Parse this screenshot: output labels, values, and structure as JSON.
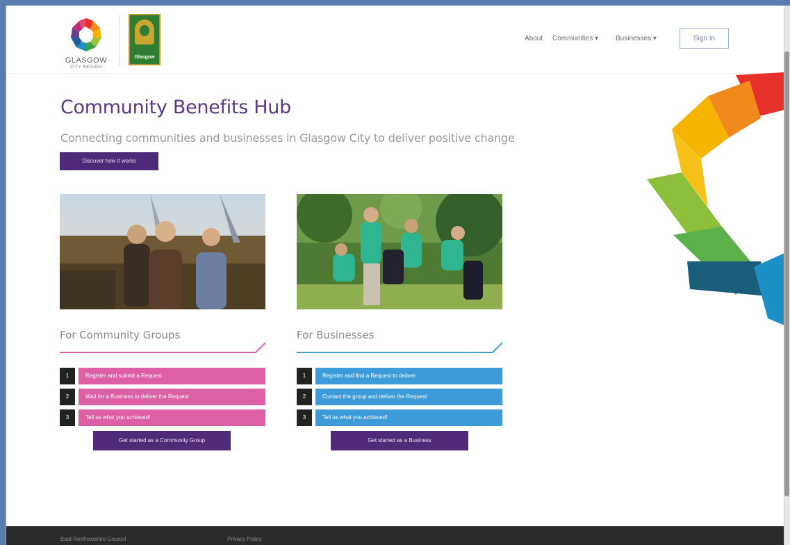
{
  "header": {
    "gcr_logo_line1": "GLASGOW",
    "gcr_logo_line2": "CITY REGION",
    "council_logo_text": "Glasgow",
    "nav": {
      "about": "About",
      "communities": "Communities ▾",
      "businesses": "Businesses ▾"
    },
    "signin_label": "Sign In"
  },
  "hero": {
    "title": "Community Benefits Hub",
    "subtitle": "Connecting communities and businesses in Glasgow City to deliver positive change",
    "button_label": "Discover how it works"
  },
  "community": {
    "heading": "For Community Groups",
    "accent_color": "#dd5fa4",
    "steps": [
      {
        "num": "1",
        "label": "Register and submit a Request"
      },
      {
        "num": "2",
        "label": "Wait for a Business to deliver the Request"
      },
      {
        "num": "3",
        "label": "Tell us what you achieved!"
      }
    ],
    "cta_label": "Get started as a Community Group"
  },
  "business": {
    "heading": "For Businesses",
    "accent_color": "#3e9bd9",
    "steps": [
      {
        "num": "1",
        "label": "Register and find a Request to deliver"
      },
      {
        "num": "2",
        "label": "Contact the group and deliver the Request"
      },
      {
        "num": "3",
        "label": "Tell us what you achieved!"
      }
    ],
    "cta_label": "Get started as a Business"
  },
  "footer": {
    "council_link": "East Renfrewshire Council",
    "privacy_link": "Privacy Policy"
  },
  "colors": {
    "brand_purple": "#4e2a78",
    "title_purple": "#5b3a80",
    "community_pink": "#dd5fa4",
    "business_blue": "#3e9bd9"
  }
}
